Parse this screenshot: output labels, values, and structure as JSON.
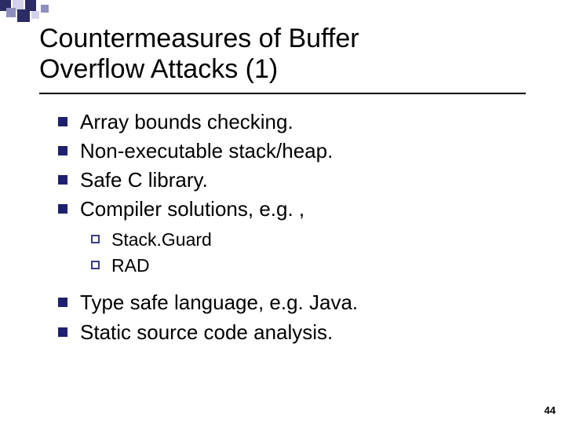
{
  "title_line1": "Countermeasures of Buffer",
  "title_line2": "Overflow Attacks (1)",
  "bullets1": {
    "b0": "Array bounds checking.",
    "b1": "Non-executable stack/heap.",
    "b2": "Safe C library.",
    "b3": "Compiler solutions, e.g. ,"
  },
  "sub": {
    "s0": "Stack.Guard",
    "s1": "RAD"
  },
  "bullets2": {
    "b0": "Type safe language, e.g. Java.",
    "b1": "Static source code analysis."
  },
  "page_number": "44",
  "deco_colors": {
    "dark": "#2b2b66",
    "mid": "#8e8ebf",
    "light": "#d2d2e8"
  }
}
